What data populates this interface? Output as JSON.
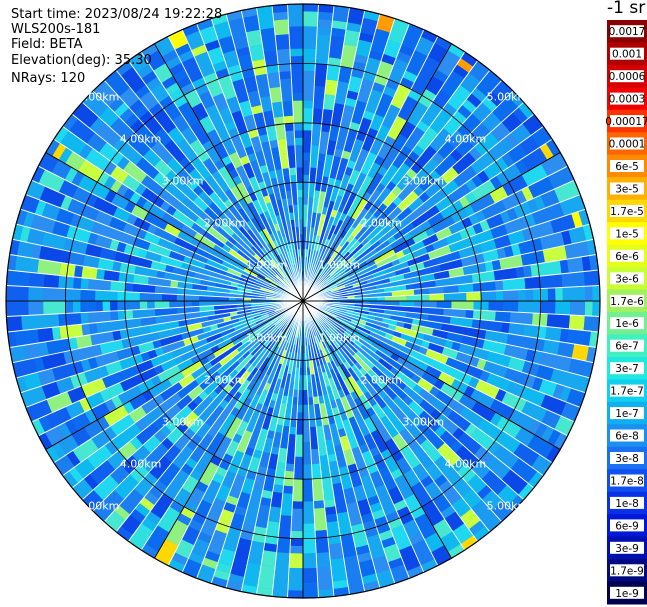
{
  "info": {
    "start_time": "Start time: 2023/08/24 19:22:28",
    "device": "WLS200s-181",
    "field": "Field: BETA",
    "elevation": "Elevation(deg): 35.30",
    "nrays": "NRays: 120"
  },
  "chart_data": {
    "type": "heatmap",
    "projection": "polar-ppi",
    "rays": 120,
    "range_rings_km": [
      1.0,
      2.0,
      3.0,
      4.0,
      5.0
    ],
    "range_labels": [
      "1.00km",
      "2.00km",
      "3.00km",
      "4.00km",
      "5.00km"
    ],
    "scale": "log",
    "colorbar": {
      "unit_label": "-1 sr",
      "ticks": [
        {
          "label": "0.0017",
          "color": "#8b0000"
        },
        {
          "label": "0.001",
          "color": "#b00000"
        },
        {
          "label": "0.0006",
          "color": "#d40000"
        },
        {
          "label": "0.0003",
          "color": "#f00000"
        },
        {
          "label": "0.00017",
          "color": "#ff3300"
        },
        {
          "label": "0.0001",
          "color": "#ff6600"
        },
        {
          "label": "6e-5",
          "color": "#ff8c00"
        },
        {
          "label": "3e-5",
          "color": "#ffb000"
        },
        {
          "label": "1.7e-5",
          "color": "#ffd800"
        },
        {
          "label": "1e-5",
          "color": "#ffff00"
        },
        {
          "label": "6e-6",
          "color": "#e6ff1a"
        },
        {
          "label": "3e-6",
          "color": "#c8ff33"
        },
        {
          "label": "1.7e-6",
          "color": "#a0f060"
        },
        {
          "label": "1e-6",
          "color": "#70f090"
        },
        {
          "label": "6e-7",
          "color": "#40f0c0"
        },
        {
          "label": "3e-7",
          "color": "#20e8e0"
        },
        {
          "label": "1.7e-7",
          "color": "#10d0f0"
        },
        {
          "label": "1e-7",
          "color": "#10b0f0"
        },
        {
          "label": "6e-8",
          "color": "#1a90f0"
        },
        {
          "label": "3e-8",
          "color": "#1a70f0"
        },
        {
          "label": "1.7e-8",
          "color": "#1050f0"
        },
        {
          "label": "1e-8",
          "color": "#0a30e8"
        },
        {
          "label": "6e-9",
          "color": "#0018d8"
        },
        {
          "label": "3e-9",
          "color": "#0010b0"
        },
        {
          "label": "1.7e-9",
          "color": "#000a80"
        },
        {
          "label": "1e-9",
          "color": "#000050"
        }
      ]
    }
  }
}
